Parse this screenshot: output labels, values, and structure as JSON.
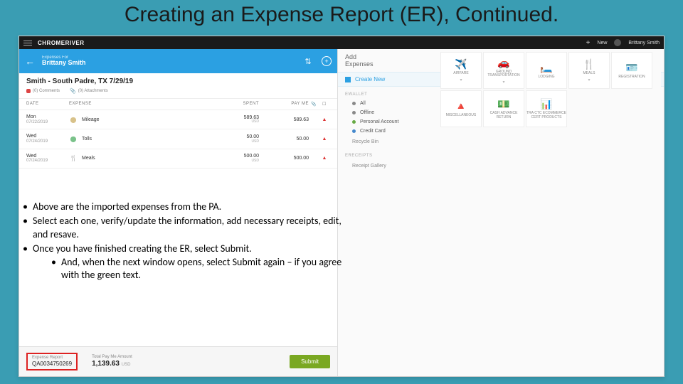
{
  "slide_title": "Creating an Expense Report (ER), Continued.",
  "topbar": {
    "logo_a": "CHROME",
    "logo_b": "RIVER",
    "new": "New",
    "user": "Brittany Smith"
  },
  "blue": {
    "sub": "Expenses For",
    "main": "Brittany Smith"
  },
  "trip": "Smith - South Padre, TX 7/29/19",
  "meta": {
    "comments": "(0) Comments",
    "attachments": "(0) Attachments"
  },
  "cols": {
    "date": "DATE",
    "expense": "EXPENSE",
    "spent": "SPENT",
    "payme": "PAY ME"
  },
  "rows": [
    {
      "dow": "Mon",
      "date": "07/22/2019",
      "icon": "⬤",
      "iconcolor": "#d8c28a",
      "name": "Mileage",
      "spent": "589.63",
      "payme": "589.63"
    },
    {
      "dow": "Wed",
      "date": "07/24/2019",
      "icon": "⬤",
      "iconcolor": "#7ac28a",
      "name": "Tolls",
      "spent": "50.00",
      "payme": "50.00"
    },
    {
      "dow": "Wed",
      "date": "07/24/2019",
      "icon": "🍴",
      "iconcolor": "#555",
      "name": "Meals",
      "spent": "500.00",
      "payme": "500.00"
    }
  ],
  "currency": "USD",
  "footer": {
    "er_lbl": "Expense Report",
    "er_val": "QA0034750269",
    "total_lbl": "Total Pay Me Amount",
    "total_val": "1,139.63",
    "submit": "Submit"
  },
  "addexp": {
    "title": "Add\nExpenses",
    "create": "Create New",
    "ewallet": "eWallet",
    "filters": [
      {
        "label": "All",
        "color": "gray"
      },
      {
        "label": "Offline",
        "color": "gray"
      },
      {
        "label": "Personal Account",
        "color": "green"
      },
      {
        "label": "Credit Card",
        "color": "blue"
      }
    ],
    "recycle": "Recycle Bin",
    "ereceipts": "eReceipts",
    "gallery": "Receipt Gallery"
  },
  "tiles": [
    {
      "icon": "✈️",
      "label": "AIRFARE",
      "chev": true
    },
    {
      "icon": "🚗",
      "label": "GROUND TRANSPORTATION",
      "chev": true
    },
    {
      "icon": "🛏️",
      "label": "LODGING",
      "chev": false
    },
    {
      "icon": "🍴",
      "label": "MEALS",
      "chev": true
    },
    {
      "icon": "🪪",
      "label": "REGISTRATION",
      "chev": false
    },
    {
      "icon": "🔺",
      "label": "MISCELLANEOUS",
      "chev": false
    },
    {
      "icon": "💵",
      "label": "CASH ADVANCE RETURN",
      "chev": false
    },
    {
      "icon": "📊",
      "label": "TRA CTC ECOMMERCE CERT PRODUCTS",
      "chev": false
    }
  ],
  "bullets": {
    "b1": "Above are the imported expenses from the PA.",
    "b2": "Select each one, verify/update the information, add necessary receipts, edit, and resave.",
    "b3": "Once you have finished creating the ER, select Submit.",
    "b3a": "And, when the next window opens, select Submit again – if you agree with the green text."
  }
}
